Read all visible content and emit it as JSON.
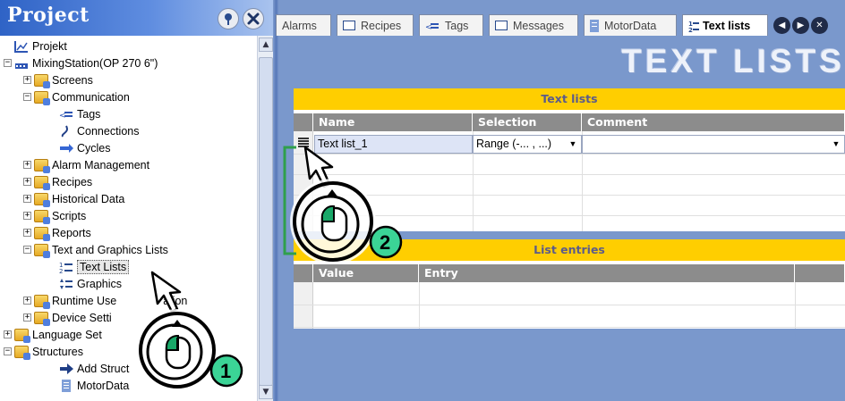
{
  "project_panel": {
    "title": "Project",
    "tree": [
      {
        "label": "Projekt",
        "icon": "project-icon",
        "expander": "",
        "indent": 0
      },
      {
        "label": "MixingStation(OP 270 6\")",
        "icon": "device-icon",
        "expander": "−",
        "indent": 0
      },
      {
        "label": "Screens",
        "icon": "screens-folder-icon",
        "expander": "+",
        "indent": 1
      },
      {
        "label": "Communication",
        "icon": "communication-folder-icon",
        "expander": "−",
        "indent": 1
      },
      {
        "label": "Tags",
        "icon": "tags-icon",
        "expander": "",
        "indent": 2
      },
      {
        "label": "Connections",
        "icon": "connections-icon",
        "expander": "",
        "indent": 2
      },
      {
        "label": "Cycles",
        "icon": "cycles-icon",
        "expander": "",
        "indent": 2
      },
      {
        "label": "Alarm Management",
        "icon": "alarm-folder-icon",
        "expander": "+",
        "indent": 1
      },
      {
        "label": "Recipes",
        "icon": "recipes-folder-icon",
        "expander": "+",
        "indent": 1
      },
      {
        "label": "Historical Data",
        "icon": "historical-folder-icon",
        "expander": "+",
        "indent": 1
      },
      {
        "label": "Scripts",
        "icon": "scripts-folder-icon",
        "expander": "+",
        "indent": 1
      },
      {
        "label": "Reports",
        "icon": "reports-folder-icon",
        "expander": "+",
        "indent": 1
      },
      {
        "label": "Text and Graphics Lists",
        "icon": "text-graphics-folder-icon",
        "expander": "−",
        "indent": 1
      },
      {
        "label": "Text Lists",
        "icon": "text-lists-icon",
        "expander": "",
        "indent": 2,
        "selected": true
      },
      {
        "label": "Graphics",
        "icon": "graphics-lists-icon",
        "expander": "",
        "indent": 2
      },
      {
        "label": "Runtime Use",
        "icon": "runtime-folder-icon",
        "expander": "+",
        "indent": 1,
        "tail": "ation"
      },
      {
        "label": "Device Setti",
        "icon": "device-settings-folder-icon",
        "expander": "+",
        "indent": 1
      },
      {
        "label": "Language Set",
        "icon": "language-folder-icon",
        "expander": "+",
        "indent": 0
      },
      {
        "label": "Structures",
        "icon": "structures-folder-icon",
        "expander": "−",
        "indent": 0
      },
      {
        "label": "Add Struct",
        "icon": "add-structure-icon",
        "expander": "",
        "indent": 1
      },
      {
        "label": "MotorData",
        "icon": "motordata-icon",
        "expander": "",
        "indent": 1
      }
    ]
  },
  "tabs": [
    {
      "label": "Alarms",
      "icon": "alarms-tab-icon"
    },
    {
      "label": "Recipes",
      "icon": "recipes-tab-icon"
    },
    {
      "label": "Tags",
      "icon": "tags-tab-icon"
    },
    {
      "label": "Messages",
      "icon": "messages-tab-icon"
    },
    {
      "label": "MotorData",
      "icon": "motordata-tab-icon"
    },
    {
      "label": "Text lists",
      "icon": "text-lists-tab-icon",
      "active": true
    }
  ],
  "editor": {
    "title": "TEXT LISTS",
    "text_lists_section": {
      "header": "Text lists",
      "columns": [
        "Name",
        "Selection",
        "Comment"
      ],
      "rows": [
        {
          "name": "Text list_1",
          "selection": "Range (-... , ...)",
          "comment": ""
        }
      ]
    },
    "list_entries_section": {
      "header": "List entries",
      "columns": [
        "Value",
        "Entry"
      ]
    }
  },
  "callouts": [
    {
      "number": "1",
      "icon": "mouse-click-icon"
    },
    {
      "number": "2",
      "icon": "mouse-click-icon"
    }
  ],
  "colors": {
    "section_header": "#ffce00",
    "column_header": "#8c8c8c",
    "panel_blue": "#7a98cc",
    "badge_green": "#3bd496"
  }
}
